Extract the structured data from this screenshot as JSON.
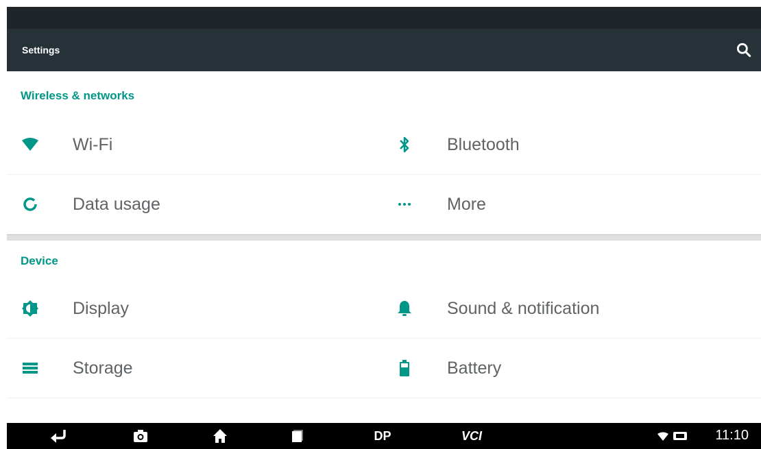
{
  "app_bar": {
    "title": "Settings",
    "search_icon": "search-icon"
  },
  "sections": [
    {
      "title": "Wireless & networks",
      "items": [
        {
          "label": "Wi-Fi",
          "icon": "wifi-icon"
        },
        {
          "label": "Bluetooth",
          "icon": "bluetooth-icon"
        },
        {
          "label": "Data usage",
          "icon": "data-usage-icon"
        },
        {
          "label": "More",
          "icon": "more-icon"
        }
      ]
    },
    {
      "title": "Device",
      "items": [
        {
          "label": "Display",
          "icon": "brightness-icon"
        },
        {
          "label": "Sound & notification",
          "icon": "bell-icon"
        },
        {
          "label": "Storage",
          "icon": "storage-icon"
        },
        {
          "label": "Battery",
          "icon": "battery-icon"
        }
      ]
    }
  ],
  "nav_bar": {
    "dp_label": "DP",
    "vci_label": "VCI",
    "time": "11:10"
  },
  "colors": {
    "accent": "#009688",
    "app_bar": "#263238",
    "text": "#5f6366"
  }
}
